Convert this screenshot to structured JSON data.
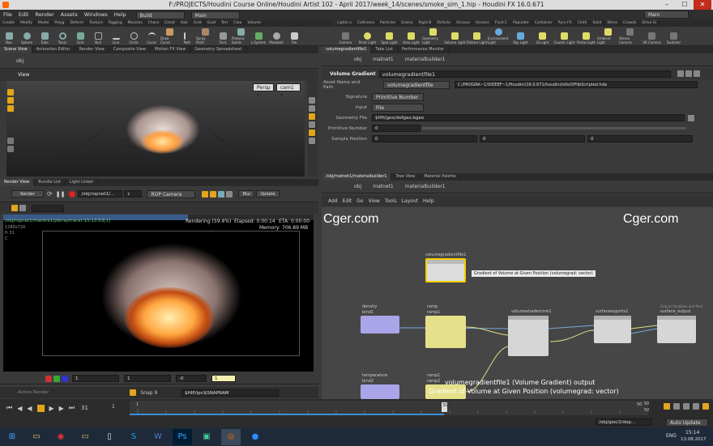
{
  "window": {
    "title": "F:/PROJECTS/Houdini Course Online/Houdini Artist 102 - April 2017/week_14/scenes/smoke_sim_1.hip - Houdini FX 16.0.671",
    "min": "–",
    "max": "☐",
    "close": "✕"
  },
  "menu": {
    "items": [
      "File",
      "Edit",
      "Render",
      "Assets",
      "Windows",
      "Help"
    ],
    "build": "Build",
    "main": "Main",
    "main_right": "Main"
  },
  "shelf_left": {
    "tabs": [
      "Create",
      "Modify",
      "Model",
      "Polyg",
      "Deform",
      "Texture",
      "Rigging",
      "Muscles",
      "Chara",
      "Const",
      "Hair",
      "Grid",
      "Guid",
      "Terr",
      "Clou",
      "Volume"
    ],
    "tools": [
      "Box",
      "Sphere",
      "Tube",
      "Torus",
      "Grid",
      "Null",
      "Line",
      "Circle",
      "Curve",
      "Draw Curve",
      "Path",
      "Spray Paint",
      "Font",
      "Platonic Solids",
      "L-System",
      "Metaball",
      "File"
    ]
  },
  "shelf_right": {
    "tabs": [
      "Lights a",
      "Collisions",
      "Particles",
      "Grains",
      "Rigid B",
      "Particle",
      "Viscous",
      "Oceans",
      "Fluid C",
      "Populate",
      "Container",
      "Pyro FX",
      "Cloth",
      "Solid",
      "Wires",
      "Crowds",
      "Drive Si"
    ],
    "tools": [
      "Camera",
      "Point Light",
      "Spot Light",
      "Area Light",
      "Geometry Light",
      "Volume Light",
      "Distant Light",
      "Environment Light",
      "Sky Light",
      "GI Light",
      "Caustic Light",
      "Portal Light",
      "Ambient Light",
      "Stereo Camera",
      "VR Camera",
      "Switcher"
    ]
  },
  "scene_tabs": [
    "Scene View",
    "Animation Editor",
    "Render View",
    "Composite View",
    "Motion FX View",
    "Geometry Spreadsheet"
  ],
  "scene_path": "obj",
  "viewport": {
    "label": "View",
    "persp": "Persp ▾",
    "cam": "cam1 ▾"
  },
  "render_tabs": [
    "Render View",
    "Bundle List",
    "Light Linker"
  ],
  "render_toolbar": {
    "render": "Render",
    "path": "/obj/ropnet1/...",
    "frame": "c",
    "camera": "ROP Camera",
    "blur": "Blur",
    "update": "Update"
  },
  "render_view": {
    "path": "/obj/ropnet1/mantra1(pbrraytrace)-15:13:53[1]",
    "res": "1280x720",
    "frame": "fr 31",
    "chan": "C",
    "status": "Rendering (59.4%)",
    "elapsed": "Elapsed: 0:00:14",
    "eta": "ETA: 0:00:00",
    "memory": "Memory: 706.89 MB"
  },
  "render_bottom": {
    "v1": "1",
    "v2": "1",
    "v3": "-0",
    "v4": "1"
  },
  "param_tabs": [
    "volumegradientfile1",
    "Take List",
    "Performance Monitor"
  ],
  "param_path": [
    "obj",
    "matnet1",
    "materialbuilder1"
  ],
  "node_header": {
    "type": "Volume Gradient",
    "name": "volumegradientfile1"
  },
  "params": {
    "asset_label": "Asset Name and Path",
    "asset_value": "volumegradientfile",
    "asset_path": "C:/PROGRA~1/SIDEEF~1/Houdini/16.0.671/houdini/otls/OPlibScripted.hda",
    "signature_label": "Signature",
    "signature_value": "Primitive Number",
    "input_label": "Input",
    "input_value": "File",
    "geofile_label": "Geometry File",
    "geofile_value": "$HH/geo/defgeo.bgeo",
    "primnum_label": "Primitive Number",
    "primnum_value": "0",
    "samplepos_label": "Sample Position",
    "samplepos_values": [
      "0",
      "0",
      "0"
    ]
  },
  "network_tabs": [
    "/obj/matnet1/materialbuilder1",
    "Tree View",
    "Material Palette"
  ],
  "network_path": [
    "obj",
    "matnet1",
    "materialbuilder1"
  ],
  "network_menu": [
    "Add",
    "Edit",
    "Go",
    "View",
    "Tools",
    "Layout",
    "Help"
  ],
  "watermark": "Cger.com",
  "nodes": [
    {
      "id": "vgf",
      "title": "volumegradientfile1",
      "tooltip": "Gradient of Volume at Given Position (volumegrad: vector)"
    },
    {
      "id": "bind1",
      "title": "density",
      "sub": "bind1"
    },
    {
      "id": "ramp1",
      "title": "ramp",
      "sub": "ramp1"
    },
    {
      "id": "vsc",
      "title": "volumeshadercore1"
    },
    {
      "id": "sfe",
      "title": "surfaceexports1"
    },
    {
      "id": "so",
      "title": "surface_output",
      "extra": "Output Variables and Para..."
    },
    {
      "id": "bind2",
      "title": "temperature",
      "sub": "bind2"
    },
    {
      "id": "ramp2",
      "title": "ramp1",
      "sub": "ramp2"
    }
  ],
  "network_hint": {
    "line1": "volumegradientfile1 (Volume Gradient) output",
    "line2": "Gradient of Volume at Given Position (volumegrad: vector)"
  },
  "timeline": {
    "frame": "31",
    "start": "1",
    "end": "1",
    "ticks": [
      "1",
      "",
      "",
      "",
      "",
      "",
      "",
      "",
      "",
      "",
      "",
      "",
      "",
      "",
      "",
      "",
      "",
      "50"
    ],
    "range_a": "50",
    "range_b": "50",
    "snap": "Snap 9",
    "path": "$HIP/ipr/$SNAPNAM",
    "active_render": "Active Render",
    "right_path": "/obj/geo/2/dop...",
    "auto_update": "Auto Update"
  },
  "taskbar": {
    "lang": "ENG",
    "time": "15:14",
    "date": "13.08.2017"
  }
}
